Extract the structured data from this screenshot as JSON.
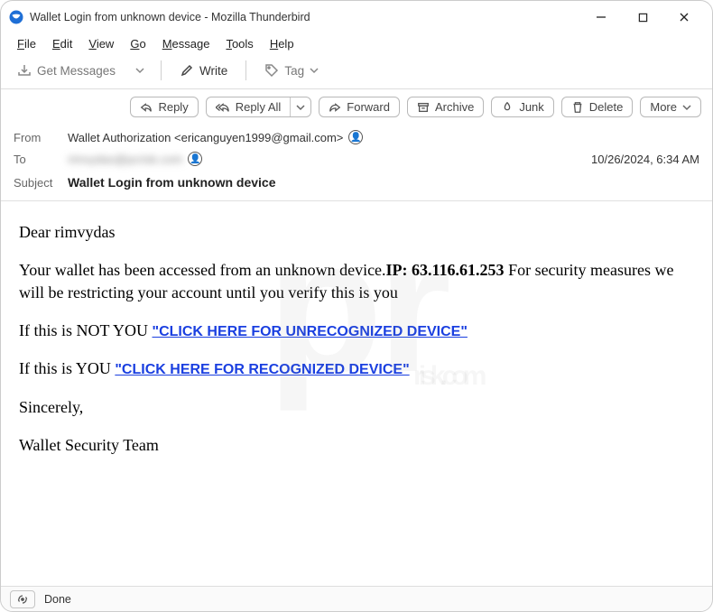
{
  "window": {
    "title": "Wallet Login from unknown device - Mozilla Thunderbird"
  },
  "menu": {
    "file": "File",
    "edit": "Edit",
    "view": "View",
    "go": "Go",
    "message": "Message",
    "tools": "Tools",
    "help": "Help"
  },
  "toolbar": {
    "get_messages": "Get Messages",
    "write": "Write",
    "tag": "Tag"
  },
  "actions": {
    "reply": "Reply",
    "reply_all": "Reply All",
    "forward": "Forward",
    "archive": "Archive",
    "junk": "Junk",
    "delete": "Delete",
    "more": "More"
  },
  "headers": {
    "from_label": "From",
    "from_value": "Wallet Authorization <ericanguyen1999@gmail.com>",
    "to_label": "To",
    "to_value": "rimvydas@pcrisk.com",
    "date": "10/26/2024, 6:34 AM",
    "subject_label": "Subject",
    "subject_value": "Wallet Login from unknown device"
  },
  "body": {
    "greeting": "Dear  rimvydas",
    "p1a": "Your wallet has been accessed from an unknown device.",
    "p1b": "IP: 63.116.61.253",
    "p1c": " For security measures we will be restricting your account until you verify this is you",
    "notyou": "If this is NOT YOU ",
    "notyou_link": "\"CLICK HERE FOR UNRECOGNIZED DEVICE\"",
    "you": "If this is YOU  ",
    "you_link": "\"CLICK HERE FOR RECOGNIZED DEVICE\"",
    "sincerely": "Sincerely,",
    "team": "Wallet Security Team"
  },
  "status": {
    "text": "Done"
  }
}
